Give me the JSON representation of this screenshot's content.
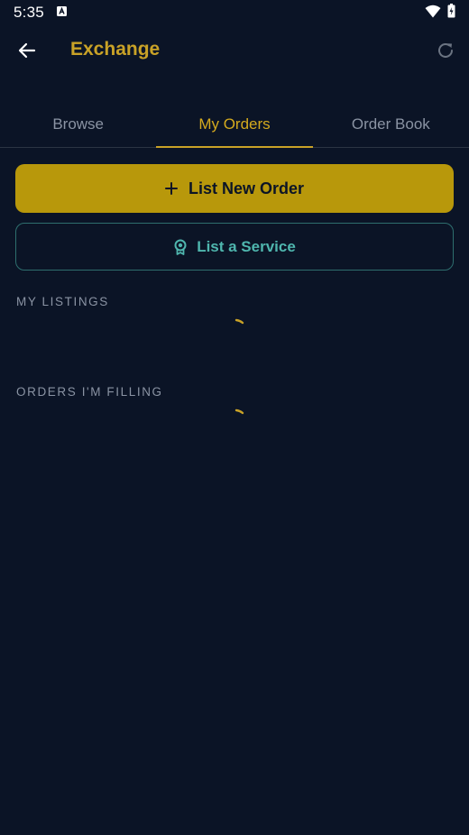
{
  "status_bar": {
    "time": "5:35"
  },
  "app_bar": {
    "title": "Exchange",
    "back_icon": "arrow-left-icon",
    "refresh_icon": "refresh-icon"
  },
  "tabs": [
    {
      "label": "Browse",
      "active": false
    },
    {
      "label": "My Orders",
      "active": true
    },
    {
      "label": "Order Book",
      "active": false
    }
  ],
  "actions": {
    "primary_label": "List New Order",
    "primary_icon": "plus-icon",
    "secondary_label": "List a Service",
    "secondary_icon": "badge-icon"
  },
  "sections": {
    "my_listings": "MY LISTINGS",
    "orders_filling": "ORDERS I'M FILLING"
  },
  "colors": {
    "background": "#0b1426",
    "accent": "#c9a227",
    "primary_button": "#b8980b",
    "teal": "#4fb6ae",
    "muted": "#8a93a3"
  }
}
